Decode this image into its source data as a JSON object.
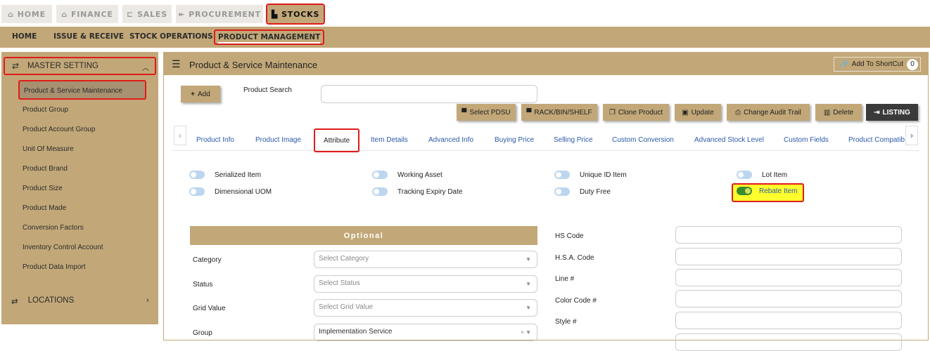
{
  "top_tabs": [
    {
      "label": "HOME",
      "icon": "home-icon"
    },
    {
      "label": "FINANCE",
      "icon": "bank-icon"
    },
    {
      "label": "SALES",
      "icon": "cart-icon"
    },
    {
      "label": "PROCUREMENT",
      "icon": "handshake-icon"
    },
    {
      "label": "STOCKS",
      "icon": "factory-icon"
    }
  ],
  "sub_nav": [
    "HOME",
    "ISSUE & RECEIVE",
    "STOCK OPERATIONS",
    "PRODUCT MANAGEMENT"
  ],
  "sidebar": {
    "header": "MASTER SETTING",
    "items": [
      "Product & Service Maintenance",
      "Product Group",
      "Product Account Group",
      "Unit Of Measure",
      "Product Brand",
      "Product Size",
      "Product Made",
      "Conversion Factors",
      "Inventory Control Account",
      "Product Data Import"
    ],
    "locations": "LOCATIONS"
  },
  "main": {
    "title": "Product & Service Maintenance",
    "shortcut_label": "Add To ShortCut",
    "shortcut_count": "0",
    "add_label": "Add",
    "search_label": "Product Search",
    "actions": [
      "Select PDSU",
      "RACK/BIN/SHELF",
      "Clone Product",
      "Update",
      "Change Audit Trail",
      "Delete",
      "LISTING"
    ],
    "tabs": [
      "Product Info",
      "Product Image",
      "Attribute",
      "Item Details",
      "Advanced Info",
      "Buying Price",
      "Selling Price",
      "Custom Conversion",
      "Advanced Stock Level",
      "Custom Fields",
      "Product Compatib"
    ],
    "toggles": [
      {
        "label": "Serialized Item",
        "on": false
      },
      {
        "label": "Working Asset",
        "on": false
      },
      {
        "label": "Unique ID Item",
        "on": false
      },
      {
        "label": "Lot Item",
        "on": false
      },
      {
        "label": "Dimensional UOM",
        "on": false
      },
      {
        "label": "Tracking Expiry Date",
        "on": false
      },
      {
        "label": "Duty Free",
        "on": false
      },
      {
        "label": "Rebate Item",
        "on": true
      }
    ],
    "optional_header": "Optional",
    "optional_fields": [
      {
        "label": "Category",
        "value": "Select Category"
      },
      {
        "label": "Status",
        "value": "Select Status"
      },
      {
        "label": "Grid Value",
        "value": "Select Grid Value"
      },
      {
        "label": "Group",
        "value": "Implementation Service"
      }
    ],
    "right_fields": [
      "HS Code",
      "H.S.A. Code",
      "Line #",
      "Color Code #",
      "Style #"
    ]
  },
  "colors": {
    "accent": "#c2a878",
    "highlight": "#ffff2e",
    "alert": "#e01b1b",
    "link": "#2a59a8"
  }
}
